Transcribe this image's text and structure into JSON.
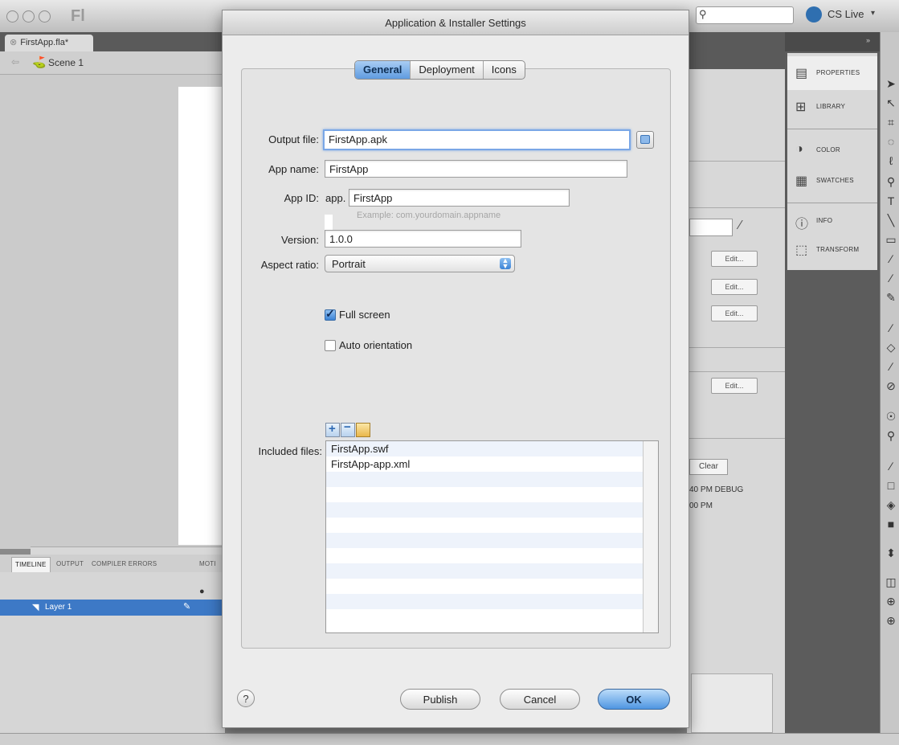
{
  "app": {
    "logo_glyph": "Fl",
    "search_placeholder": "",
    "cslive_label": "CS Live",
    "document_tab": "FirstApp.fla*",
    "scene_label": "Scene 1"
  },
  "bottom_panel": {
    "tabs": [
      "TIMELINE",
      "OUTPUT",
      "COMPILER ERRORS",
      "MOTI"
    ],
    "layer_name": "Layer 1"
  },
  "properties": {
    "edit_buttons": [
      "Edit...",
      "Edit...",
      "Edit...",
      "Edit..."
    ],
    "clear_label": "Clear",
    "log_lines": [
      "40 PM  DEBUG",
      "00 PM"
    ]
  },
  "panels": [
    {
      "label": "PROPERTIES",
      "icon": "properties-icon",
      "glyph": "▤"
    },
    {
      "label": "LIBRARY",
      "icon": "library-icon",
      "glyph": "⊞"
    },
    {
      "label": "COLOR",
      "icon": "color-icon",
      "glyph": "◑"
    },
    {
      "label": "SWATCHES",
      "icon": "swatches-icon",
      "glyph": "▦"
    },
    {
      "label": "INFO",
      "icon": "info-icon",
      "glyph": "ⓘ"
    },
    {
      "label": "TRANSFORM",
      "icon": "transform-icon",
      "glyph": "⬚"
    }
  ],
  "tools": [
    "➤",
    "↖",
    "⌗",
    "◌",
    "ℓ",
    "⚲",
    "T",
    "╲",
    "▭",
    "∕",
    "∕",
    "✎",
    "∕",
    "◇",
    "∕",
    "⊘",
    "☉",
    "⚲",
    "∕",
    "□",
    "◈",
    "■",
    "⬍",
    "◫",
    "⊕",
    "⊕"
  ],
  "dialog": {
    "title": "Application & Installer Settings",
    "tabs": [
      {
        "label": "General",
        "active": true
      },
      {
        "label": "Deployment",
        "active": false
      },
      {
        "label": "Icons",
        "active": false
      }
    ],
    "output_file": {
      "label": "Output file:",
      "value": "FirstApp.apk"
    },
    "app_name": {
      "label": "App name:",
      "value": "FirstApp"
    },
    "app_id": {
      "label": "App ID:",
      "prefix": "app.",
      "value": "FirstApp",
      "example": "Example: com.yourdomain.appname"
    },
    "version": {
      "label": "Version:",
      "value": "1.0.0"
    },
    "aspect_ratio": {
      "label": "Aspect ratio:",
      "value": "Portrait"
    },
    "full_screen": {
      "label": "Full screen",
      "checked": true
    },
    "auto_orientation": {
      "label": "Auto orientation",
      "checked": false
    },
    "included_files": {
      "label": "Included files:",
      "items": [
        "FirstApp.swf",
        "FirstApp-app.xml"
      ]
    },
    "buttons": {
      "help": "?",
      "publish": "Publish",
      "cancel": "Cancel",
      "ok": "OK"
    }
  },
  "colors": {
    "accent": "#5f9be0",
    "selection": "#3d79c6",
    "dialog_bg": "#ececec"
  }
}
